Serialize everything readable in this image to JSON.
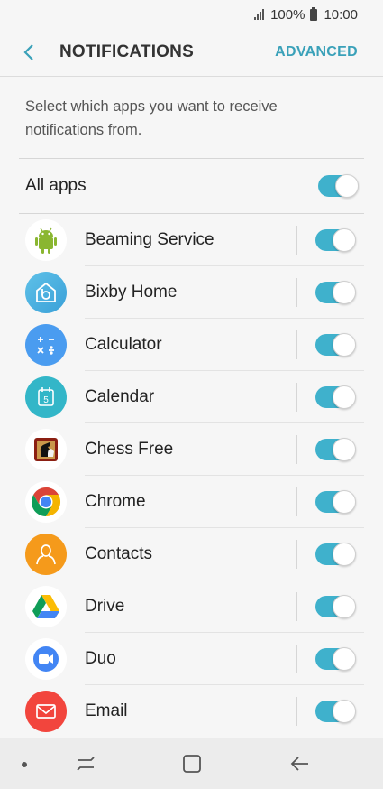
{
  "status": {
    "battery": "100%",
    "time": "10:00"
  },
  "header": {
    "title": "NOTIFICATIONS",
    "advanced": "ADVANCED"
  },
  "description": "Select which apps you want to receive notifications from.",
  "all_apps": {
    "label": "All apps",
    "on": true
  },
  "apps": [
    {
      "label": "Beaming Service",
      "icon": "android-robot-icon",
      "on": true
    },
    {
      "label": "Bixby Home",
      "icon": "bixby-home-icon",
      "on": true
    },
    {
      "label": "Calculator",
      "icon": "calculator-icon",
      "on": true
    },
    {
      "label": "Calendar",
      "icon": "calendar-icon",
      "on": true
    },
    {
      "label": "Chess Free",
      "icon": "chess-icon",
      "on": true
    },
    {
      "label": "Chrome",
      "icon": "chrome-icon",
      "on": true
    },
    {
      "label": "Contacts",
      "icon": "contacts-icon",
      "on": true
    },
    {
      "label": "Drive",
      "icon": "drive-icon",
      "on": true
    },
    {
      "label": "Duo",
      "icon": "duo-icon",
      "on": true
    },
    {
      "label": "Email",
      "icon": "email-icon",
      "on": true
    }
  ],
  "calendar_day": "5",
  "colors": {
    "accent": "#3fb1cc",
    "header_link": "#3aa1b9"
  }
}
